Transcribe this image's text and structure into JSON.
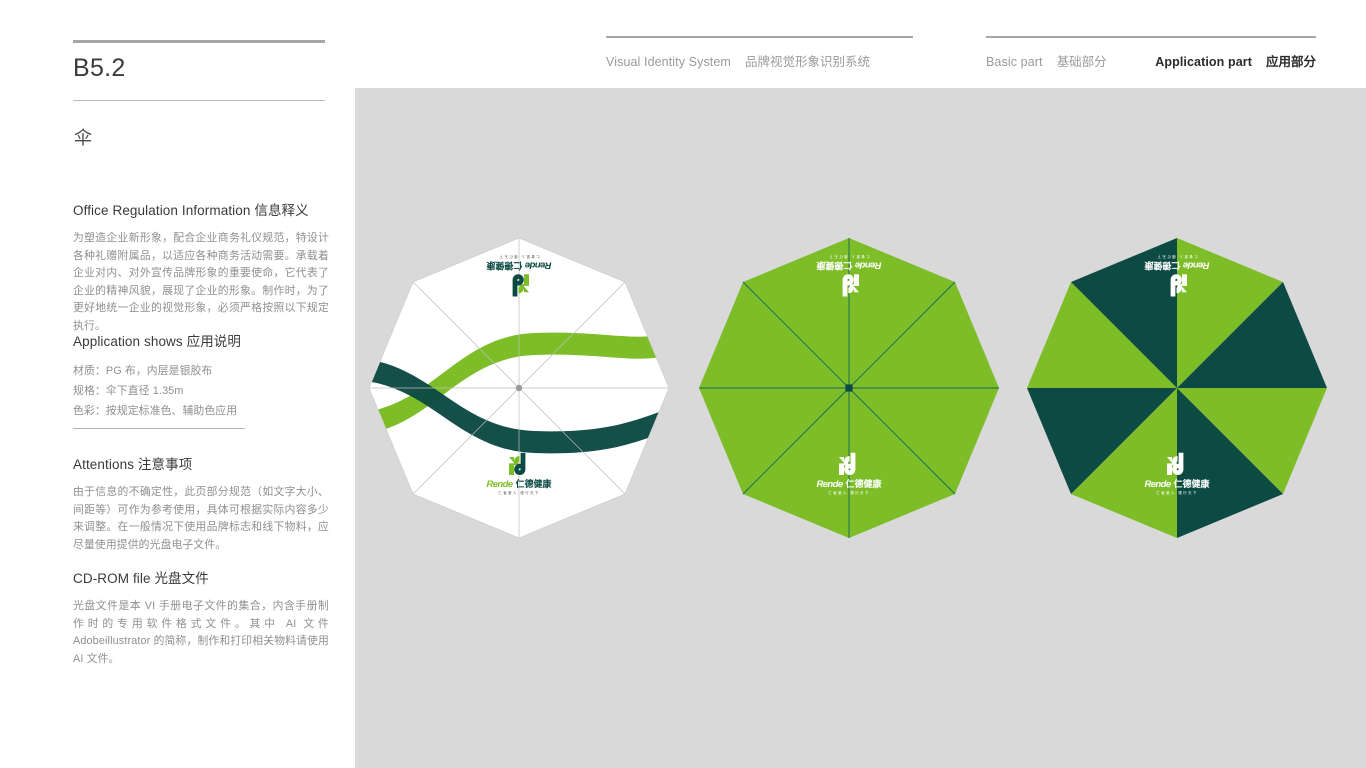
{
  "header": {
    "left_group": {
      "en": "Visual Identity System",
      "cn": "品牌视觉形象识别系统"
    },
    "right_group": {
      "basic_en": "Basic part",
      "basic_cn": "基础部分",
      "application_en": "Application part",
      "application_cn": "应用部分"
    }
  },
  "page": {
    "code": "B5.2",
    "item_icon_char": "伞"
  },
  "sections": {
    "info": {
      "title": "Office Regulation Information 信息释义",
      "body": "为塑造企业新形象，配合企业商务礼仪规范，特设计各种礼赠附属品，以适应各种商务活动需要。承载着企业对内、对外宣传品牌形象的重要使命，它代表了企业的精神风貌，展现了企业的形象。制作时，为了更好地统一企业的视觉形象，必须严格按照以下规定执行。"
    },
    "application": {
      "title": "Application shows 应用说明",
      "lines": [
        "材质：PG 布，内层是银胶布",
        "规格：伞下直径 1.35m",
        "色彩：按规定标准色、辅助色应用"
      ]
    },
    "attentions": {
      "title": "Attentions 注意事项",
      "body": "由于信息的不确定性，此页部分规范（如文字大小、间距等）可作为参考使用，具体可根据实际内容多少来调整。在一般情况下使用品牌标志和线下物料，应尽量使用提供的光盘电子文件。"
    },
    "cdrom": {
      "title": "CD-ROM file 光盘文件",
      "body": "光盘文件是本 VI 手册电子文件的集合，内含手册制作时的专用软件格式文件。其中 AI 文件 Adobeillustrator 的简称，制作和打印相关物料请使用 AI 文件。"
    }
  },
  "brand": {
    "logo_latin": "Rende",
    "logo_cn": "仁德健康",
    "logo_tagline": "仁者爱人  德行天下",
    "colors": {
      "green": "#7DBE28",
      "dark_teal": "#0C4A43",
      "canvas_gray": "#D9D9D9",
      "white": "#FFFFFF"
    }
  },
  "umbrellas": [
    {
      "name": "white-umbrella",
      "style": "white with dual green wave ribbons",
      "panel_colors": [
        "#FFFFFF"
      ],
      "logo_color": "green-dark"
    },
    {
      "name": "green-umbrella",
      "style": "solid green",
      "panel_colors": [
        "#7DBE28"
      ],
      "logo_color": "white"
    },
    {
      "name": "two-tone-umbrella",
      "style": "alternating dark teal and green panels",
      "panel_colors": [
        "#0C4A43",
        "#7DBE28"
      ],
      "logo_color": "white"
    }
  ]
}
